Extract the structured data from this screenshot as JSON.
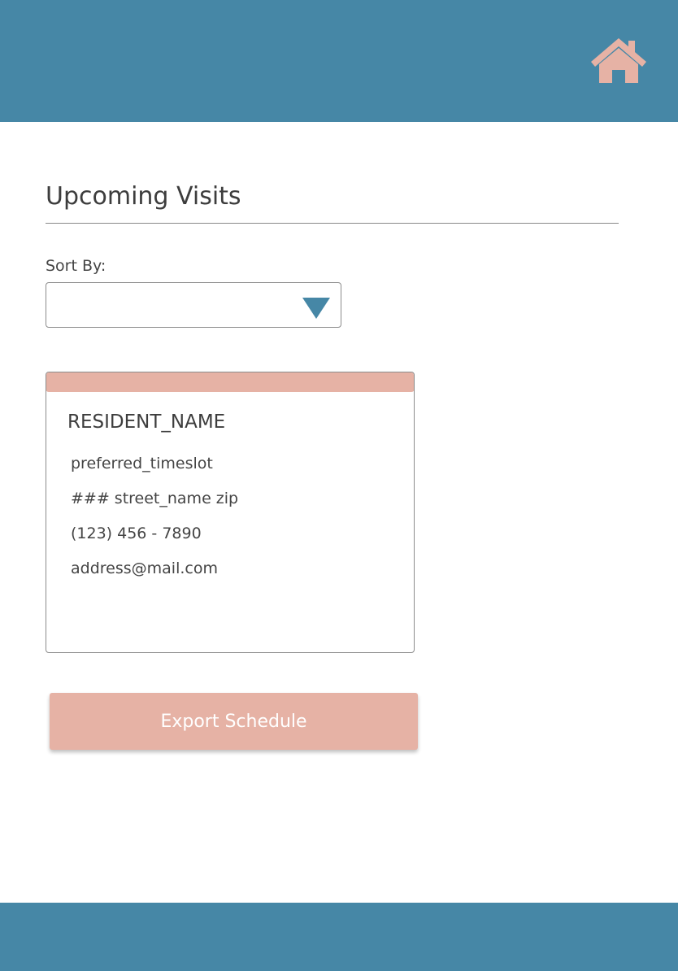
{
  "header": {
    "home_icon": "home-icon",
    "bar_color": "#4687a6",
    "icon_color": "#e6b2a5"
  },
  "main": {
    "title": "Upcoming Visits",
    "sort": {
      "label": "Sort By:",
      "selected_value": "",
      "arrow_icon": "triangle-down-icon"
    }
  },
  "visit_card": {
    "resident_name": "RESIDENT_NAME",
    "preferred_timeslot": "preferred_timeslot",
    "address": "### street_name zip",
    "phone": "(123) 456 - 7890",
    "email": "address@mail.com"
  },
  "actions": {
    "export_label": "Export Schedule"
  }
}
